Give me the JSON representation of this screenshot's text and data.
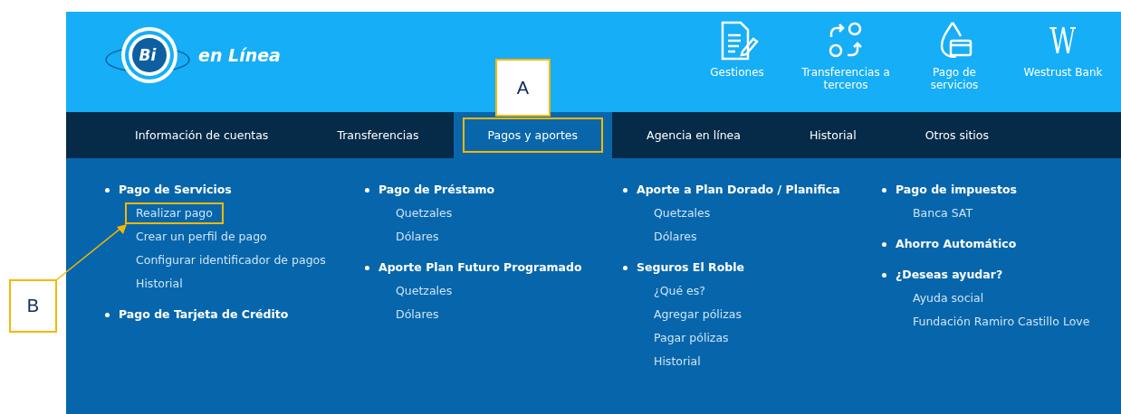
{
  "logo": {
    "badge": "Bi",
    "text": "en Línea"
  },
  "shortcuts": [
    {
      "kind": "document",
      "label": "Gestiones"
    },
    {
      "kind": "exchange",
      "label": "Transferencias a terceros"
    },
    {
      "kind": "drop-card",
      "label": "Pago de servicios"
    },
    {
      "kind": "letter",
      "glyph": "W",
      "label": "Westrust Bank"
    }
  ],
  "nav": [
    {
      "label": "Información de cuentas",
      "selected": false,
      "outlined": false
    },
    {
      "label": "Transferencias",
      "selected": false,
      "outlined": false
    },
    {
      "label": "Pagos y aportes",
      "selected": true,
      "outlined": true
    },
    {
      "label": "Agencia en línea",
      "selected": false,
      "outlined": false
    },
    {
      "label": "Historial",
      "selected": false,
      "outlined": false
    },
    {
      "label": "Otros sitios",
      "selected": false,
      "outlined": false
    }
  ],
  "menu_columns": [
    {
      "groups": [
        {
          "title": "Pago de Servicios",
          "items": [
            {
              "label": "Realizar pago",
              "outlined": true
            },
            {
              "label": "Crear un perfil de pago",
              "outlined": false
            },
            {
              "label": "Configurar identificador de pagos",
              "outlined": false
            },
            {
              "label": "Historial",
              "outlined": false
            }
          ]
        },
        {
          "title": "Pago de Tarjeta de Crédito"
        }
      ]
    },
    {
      "groups": [
        {
          "title": "Pago de Préstamo",
          "items": [
            {
              "label": "Quetzales",
              "outlined": false
            },
            {
              "label": "Dólares",
              "outlined": false
            }
          ]
        },
        {
          "title": "Aporte Plan Futuro Programado",
          "items": [
            {
              "label": "Quetzales",
              "outlined": false
            },
            {
              "label": "Dólares",
              "outlined": false
            }
          ]
        }
      ]
    },
    {
      "groups": [
        {
          "title": "Aporte a Plan Dorado / Planifica",
          "items": [
            {
              "label": "Quetzales",
              "outlined": false
            },
            {
              "label": "Dólares",
              "outlined": false
            }
          ]
        },
        {
          "title": "Seguros El Roble",
          "items": [
            {
              "label": "¿Qué es?",
              "outlined": false
            },
            {
              "label": "Agregar pólizas",
              "outlined": false
            },
            {
              "label": "Pagar pólizas",
              "outlined": false
            },
            {
              "label": "Historial",
              "outlined": false
            }
          ]
        }
      ]
    },
    {
      "groups": [
        {
          "title": "Pago de impuestos",
          "items": [
            {
              "label": "Banca SAT",
              "outlined": false
            }
          ]
        },
        {
          "title": "Ahorro Automático"
        },
        {
          "title": "¿Deseas ayudar?",
          "items": [
            {
              "label": "Ayuda social",
              "outlined": false
            },
            {
              "label": "Fundación Ramiro Castillo Love",
              "outlined": false
            }
          ]
        }
      ]
    }
  ],
  "annotations": [
    {
      "label": "A",
      "kind": "above-tab"
    },
    {
      "label": "B",
      "kind": "arrow-left"
    }
  ]
}
